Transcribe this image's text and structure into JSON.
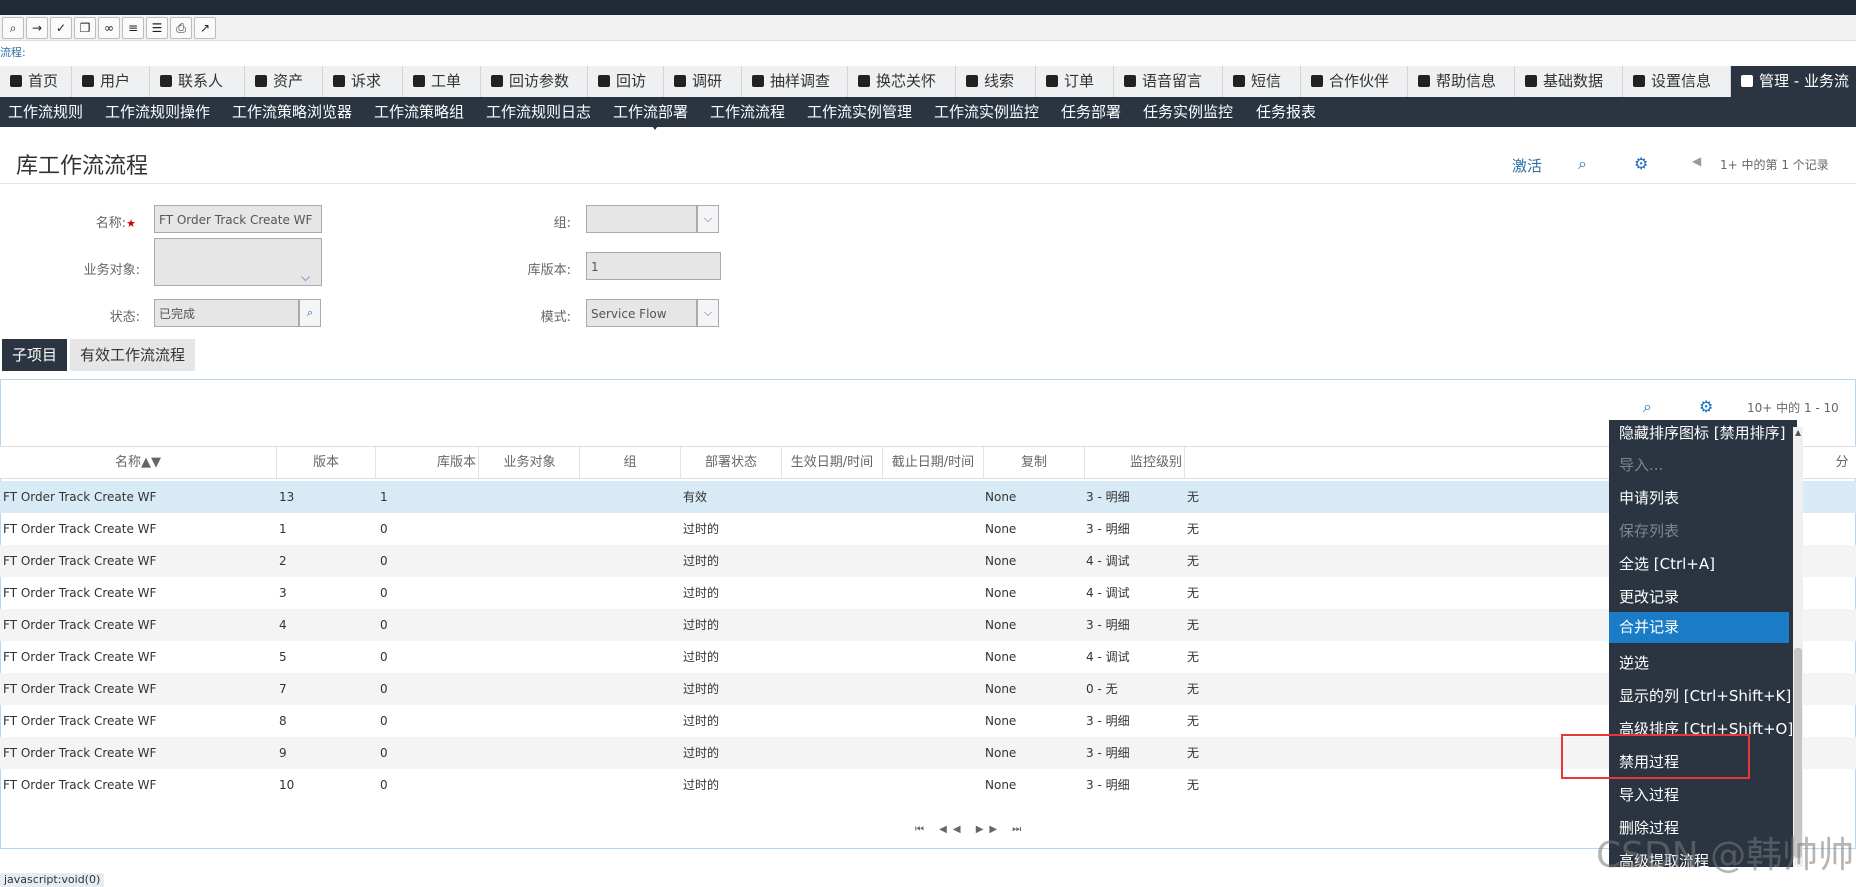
{
  "toolbar_icons": [
    "search-icon",
    "go-icon",
    "clipboard-check-icon",
    "copy-icon",
    "link-icon",
    "list-icon",
    "document-icon",
    "print-icon",
    "chart-icon"
  ],
  "breadcrumb": "流程:",
  "tabs": [
    "首页",
    "用户",
    "联系人",
    "资产",
    "诉求",
    "工单",
    "回访参数",
    "回访",
    "调研",
    "抽样调查",
    "换芯关怀",
    "线索",
    "订单",
    "语音留言",
    "短信",
    "合作伙伴",
    "帮助信息",
    "基础数据",
    "设置信息",
    "管理 - 业务流"
  ],
  "subnav": [
    "工作流规则",
    "工作流规则操作",
    "工作流策略浏览器",
    "工作流策略组",
    "工作流规则日志",
    "工作流部署",
    "工作流流程",
    "工作流实例管理",
    "工作流实例监控",
    "任务部署",
    "任务实例监控",
    "任务报表"
  ],
  "header": {
    "title": "库工作流流程",
    "activate": "激活",
    "record_info": "1+ 中的第 1 个记录"
  },
  "form": {
    "name_label": "名称:",
    "name_required": "★",
    "name_value": "FT Order Track Create WF",
    "group_label": "组:",
    "group_value": "",
    "biz_label": "业务对象:",
    "biz_value": "",
    "version_label": "库版本:",
    "version_value": "1",
    "status_label": "状态:",
    "status_value": "已完成",
    "mode_label": "模式:",
    "mode_value": "Service Flow"
  },
  "subtabs": [
    "子项目",
    "有效工作流流程"
  ],
  "list": {
    "record_info": "10+ 中的 1 - 10",
    "columns": [
      "名称▲▼",
      "版本",
      "库版本",
      "业务对象",
      "组",
      "部署状态",
      "生效日期/时间",
      "截止日期/时间",
      "复制",
      "监控级别",
      "分"
    ],
    "rows": [
      [
        "FT Order Track Create WF",
        "13",
        "1",
        "",
        "",
        "有效",
        "",
        "",
        "None",
        "3 - 明细",
        "无"
      ],
      [
        "FT Order Track Create WF",
        "1",
        "0",
        "",
        "",
        "过时的",
        "",
        "",
        "None",
        "3 - 明细",
        "无"
      ],
      [
        "FT Order Track Create WF",
        "2",
        "0",
        "",
        "",
        "过时的",
        "",
        "",
        "None",
        "4 - 调试",
        "无"
      ],
      [
        "FT Order Track Create WF",
        "3",
        "0",
        "",
        "",
        "过时的",
        "",
        "",
        "None",
        "4 - 调试",
        "无"
      ],
      [
        "FT Order Track Create WF",
        "4",
        "0",
        "",
        "",
        "过时的",
        "",
        "",
        "None",
        "3 - 明细",
        "无"
      ],
      [
        "FT Order Track Create WF",
        "5",
        "0",
        "",
        "",
        "过时的",
        "",
        "",
        "None",
        "4 - 调试",
        "无"
      ],
      [
        "FT Order Track Create WF",
        "7",
        "0",
        "",
        "",
        "过时的",
        "",
        "",
        "None",
        "0 - 无",
        "无"
      ],
      [
        "FT Order Track Create WF",
        "8",
        "0",
        "",
        "",
        "过时的",
        "",
        "",
        "None",
        "3 - 明细",
        "无"
      ],
      [
        "FT Order Track Create WF",
        "9",
        "0",
        "",
        "",
        "过时的",
        "",
        "",
        "None",
        "3 - 明细",
        "无"
      ],
      [
        "FT Order Track Create WF",
        "10",
        "0",
        "",
        "",
        "过时的",
        "",
        "",
        "None",
        "3 - 明细",
        "无"
      ]
    ],
    "pager": "⏮ ◀◀ ▶▶ ⏭"
  },
  "context_menu": [
    {
      "label": "隐藏排序图标 [禁用排序]",
      "state": "normal"
    },
    {
      "label": "导入...",
      "state": "disabled"
    },
    {
      "label": "申请列表",
      "state": "normal"
    },
    {
      "label": "保存列表",
      "state": "disabled"
    },
    {
      "label": "全选 [Ctrl+A]",
      "state": "normal"
    },
    {
      "label": "更改记录",
      "state": "normal"
    },
    {
      "label": "合并记录",
      "state": "highlighted"
    },
    {
      "label": "逆选",
      "state": "normal"
    },
    {
      "label": "显示的列 [Ctrl+Shift+K]",
      "state": "normal"
    },
    {
      "label": "高级排序 [Ctrl+Shift+O]",
      "state": "normal"
    },
    {
      "label": "禁用过程",
      "state": "normal"
    },
    {
      "label": "导入过程",
      "state": "normal"
    },
    {
      "label": "删除过程",
      "state": "normal"
    },
    {
      "label": "高级提取流程",
      "state": "normal"
    }
  ],
  "status_bar": "javascript:void(0)",
  "watermark": "CSDN @韩帅帅i",
  "colors": {
    "nav_dark": "#2b3542",
    "accent": "#1a7cc7",
    "highlight_box": "#e53935",
    "selected_row": "#d9eaf7"
  }
}
